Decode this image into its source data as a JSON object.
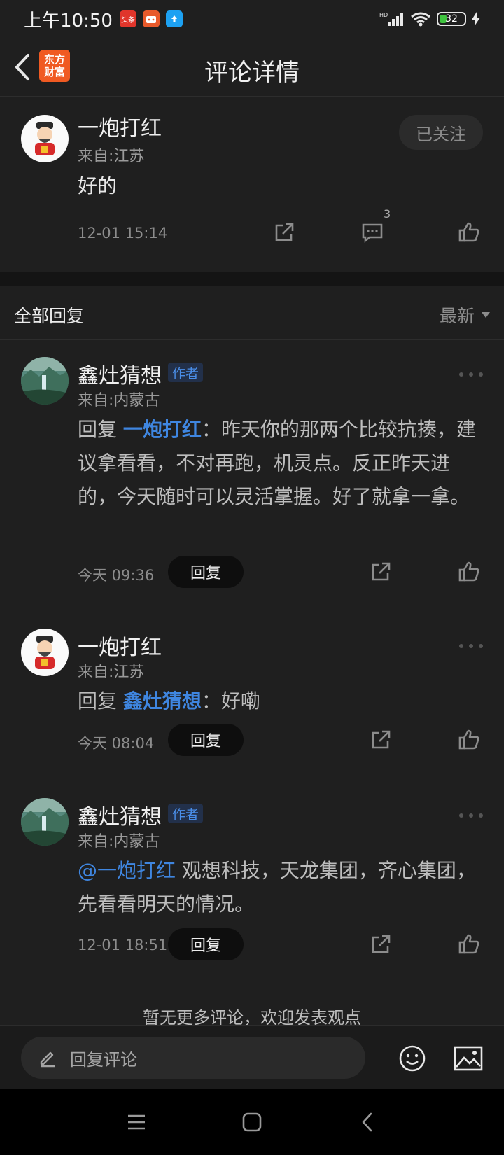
{
  "status_bar": {
    "time": "上午10:50",
    "notif_1": "头条",
    "battery": "32",
    "hd": "HD"
  },
  "header": {
    "title": "评论详情",
    "brand_line1": "东方",
    "brand_line2": "财富"
  },
  "main_comment": {
    "user": "一炮打红",
    "location": "来自:江苏",
    "follow_label": "已关注",
    "text": "好的",
    "time": "12-01 15:14",
    "comment_count": "3"
  },
  "replies_section": {
    "title": "全部回复",
    "sort_label": "最新"
  },
  "replies": [
    {
      "user": "鑫灶猜想",
      "badge": "作者",
      "location": "来自:内蒙古",
      "prefix": "回复 ",
      "mention": "一炮打红",
      "text": "：昨天你的那两个比较抗揍，建议拿看看，不对再跑，机灵点。反正昨天进的，今天随时可以灵活掌握。好了就拿一拿。",
      "time": "今天 09:36",
      "reply_label": "回复"
    },
    {
      "user": "一炮打红",
      "location": "来自:江苏",
      "prefix": "回复 ",
      "mention": "鑫灶猜想",
      "text": "：好嘞",
      "time": "今天 08:04",
      "reply_label": "回复"
    },
    {
      "user": "鑫灶猜想",
      "badge": "作者",
      "location": "来自:内蒙古",
      "at_mention": "@一炮打红",
      "text": " 观想科技，天龙集团，齐心集团，先看看明天的情况。",
      "time": "12-01 18:51",
      "reply_label": "回复"
    }
  ],
  "footer_note": "暂无更多评论，欢迎发表观点",
  "input": {
    "placeholder": "回复评论"
  },
  "icons": {
    "share": "share-icon",
    "comment": "comment-icon",
    "like": "like-icon",
    "more": "more-icon",
    "emoji": "emoji-icon",
    "image": "image-icon",
    "edit": "pencil-icon"
  },
  "colors": {
    "background": "#1f1f1f",
    "accent": "#3f86e0",
    "brand": "#f05a22"
  }
}
